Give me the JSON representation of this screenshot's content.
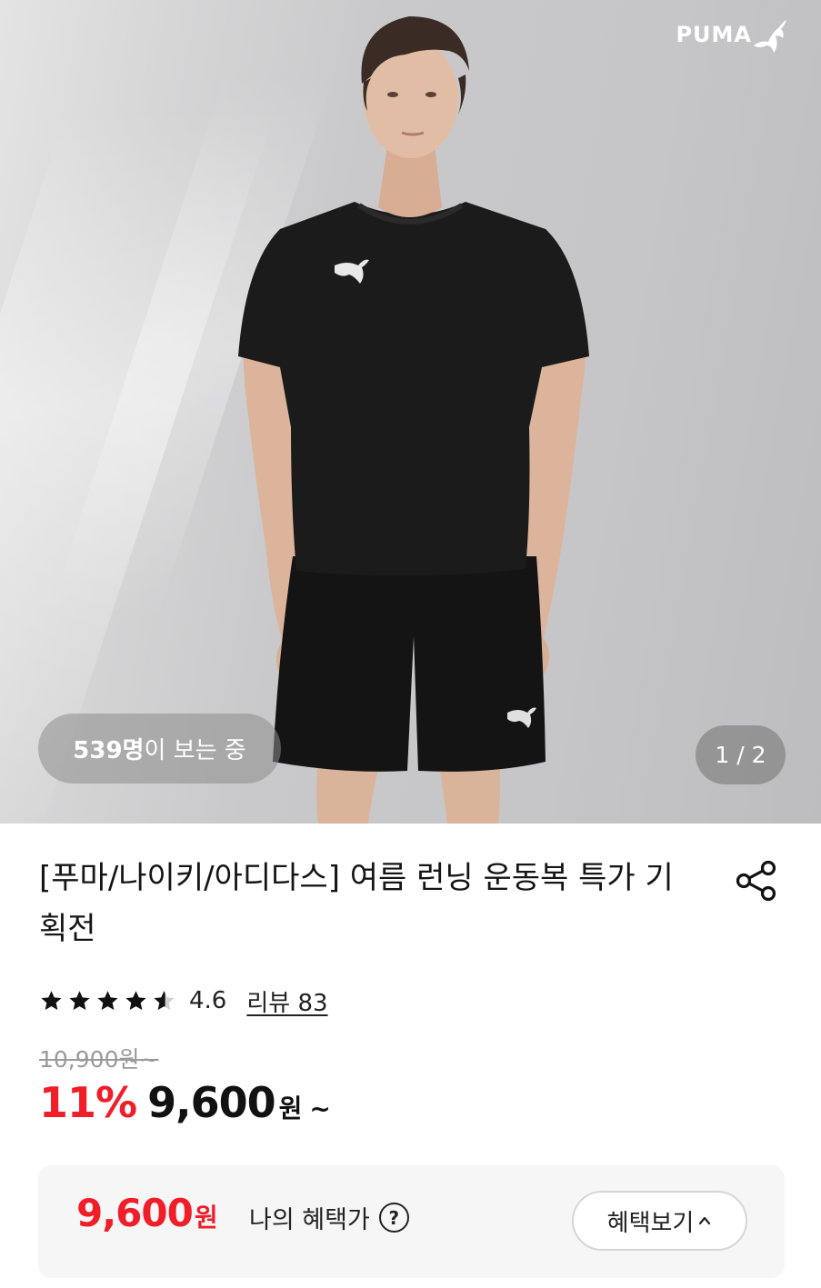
{
  "hero": {
    "brand_logo": "PUMA",
    "viewers_count": "539명",
    "viewers_suffix": "이 보는 중",
    "image_counter": "1 / 2"
  },
  "product": {
    "title": "[푸마/나이키/아디다스] 여름 런닝 운동복 특가 기획전",
    "share_icon": "share-icon",
    "rating": {
      "stars": 4.6,
      "score": "4.6",
      "reviews": "리뷰 83"
    },
    "original_price": "10,900원",
    "original_price_suffix": "~",
    "discount": "11%",
    "sale_price": "9,600",
    "sale_unit": "원",
    "sale_suffix": "~"
  },
  "benefit": {
    "price": "9,600",
    "unit": "원",
    "label": "나의 혜택가",
    "help_icon": "?",
    "button_label": "혜택보기"
  },
  "colors": {
    "accent_red": "#f01e28",
    "text_dark": "#111111",
    "muted": "#9a9a9a",
    "panel_bg": "#f6f6f6"
  }
}
